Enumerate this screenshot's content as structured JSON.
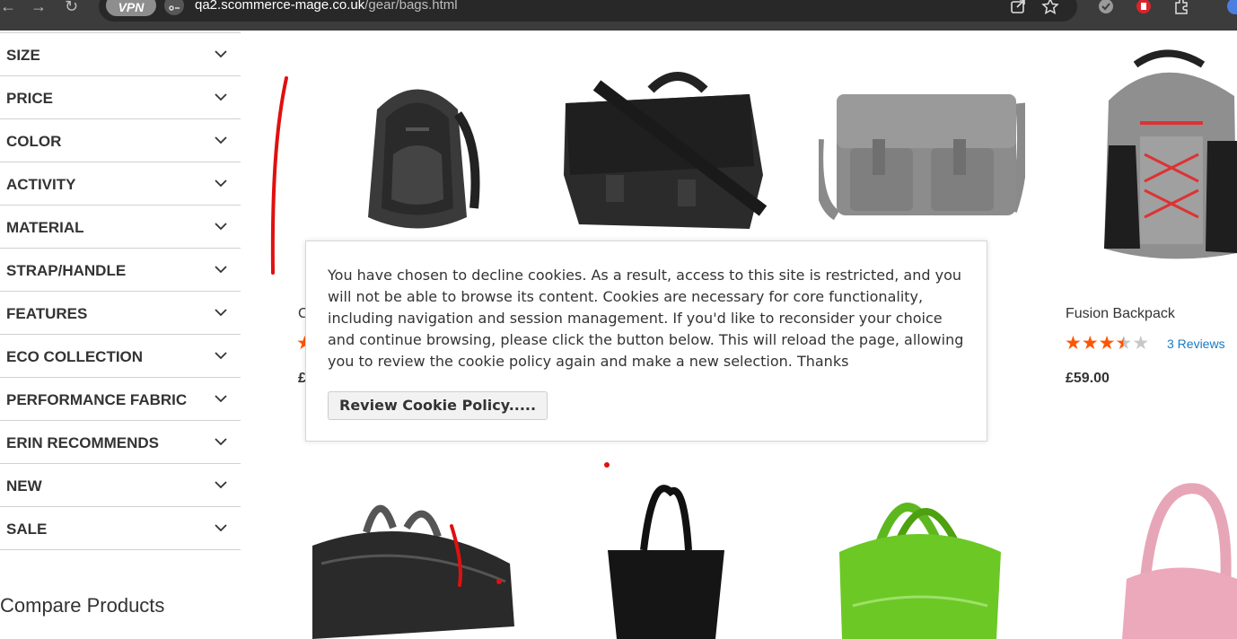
{
  "browser": {
    "vpn_label": "VPN",
    "url_host": "qa2.scommerce-mage.co.uk",
    "url_path": "/gear/bags.html"
  },
  "sidebar": {
    "filters": [
      {
        "label": "SIZE"
      },
      {
        "label": "PRICE"
      },
      {
        "label": "COLOR"
      },
      {
        "label": "ACTIVITY"
      },
      {
        "label": "MATERIAL"
      },
      {
        "label": "STRAP/HANDLE"
      },
      {
        "label": "FEATURES"
      },
      {
        "label": "ECO COLLECTION"
      },
      {
        "label": "PERFORMANCE FABRIC"
      },
      {
        "label": "ERIN RECOMMENDS"
      },
      {
        "label": "NEW"
      },
      {
        "label": "SALE"
      }
    ],
    "compare_title": "Compare Products"
  },
  "products": {
    "p1_name_partial": "C",
    "p1_price_partial": "£",
    "p4": {
      "name": "Fusion Backpack",
      "rating": 3.5,
      "max_rating": 5,
      "reviews": "3  Reviews",
      "price": "£59.00"
    }
  },
  "cookie_modal": {
    "message": "You have chosen to decline cookies. As a result, access to this site is restricted, and you will not be able to browse its content. Cookies are necessary for core functionality, including navigation and session management. If you'd like to reconsider your choice and continue browsing, please click the button below. This will reload the page, allowing you to review the cookie policy again and make a new selection. Thanks",
    "button_label": "Review Cookie Policy....."
  },
  "colors": {
    "star_on": "#ff5501",
    "star_off": "#c7c7c7",
    "link": "#1979c3",
    "annotation": "#e01010"
  }
}
